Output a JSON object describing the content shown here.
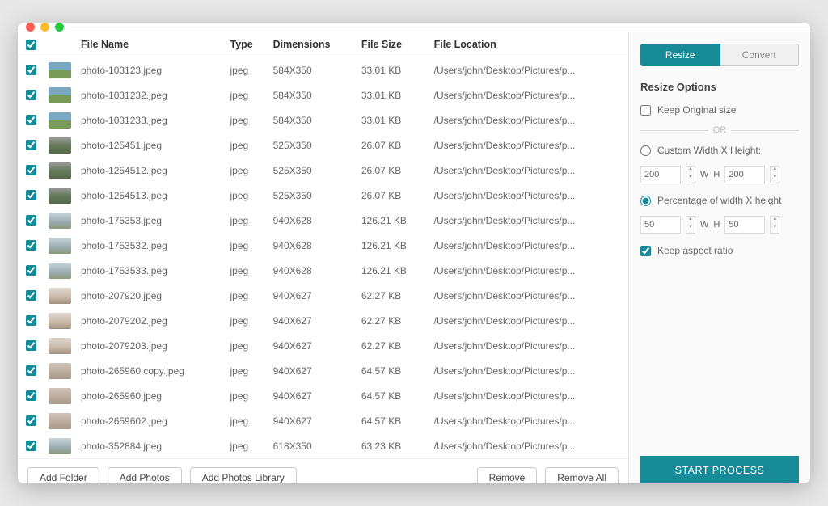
{
  "columns": {
    "fileName": "File Name",
    "type": "Type",
    "dimensions": "Dimensions",
    "fileSize": "File Size",
    "fileLocation": "File Location"
  },
  "rows": [
    {
      "thumb": "v1",
      "name": "photo-103123.jpeg",
      "type": "jpeg",
      "dim": "584X350",
      "size": "33.01 KB",
      "loc": "/Users/john/Desktop/Pictures/p..."
    },
    {
      "thumb": "v1",
      "name": "photo-1031232.jpeg",
      "type": "jpeg",
      "dim": "584X350",
      "size": "33.01 KB",
      "loc": "/Users/john/Desktop/Pictures/p..."
    },
    {
      "thumb": "v1",
      "name": "photo-1031233.jpeg",
      "type": "jpeg",
      "dim": "584X350",
      "size": "33.01 KB",
      "loc": "/Users/john/Desktop/Pictures/p..."
    },
    {
      "thumb": "v2",
      "name": "photo-125451.jpeg",
      "type": "jpeg",
      "dim": "525X350",
      "size": "26.07 KB",
      "loc": "/Users/john/Desktop/Pictures/p..."
    },
    {
      "thumb": "v2",
      "name": "photo-1254512.jpeg",
      "type": "jpeg",
      "dim": "525X350",
      "size": "26.07 KB",
      "loc": "/Users/john/Desktop/Pictures/p..."
    },
    {
      "thumb": "v2",
      "name": "photo-1254513.jpeg",
      "type": "jpeg",
      "dim": "525X350",
      "size": "26.07 KB",
      "loc": "/Users/john/Desktop/Pictures/p..."
    },
    {
      "thumb": "v3",
      "name": "photo-175353.jpeg",
      "type": "jpeg",
      "dim": "940X628",
      "size": "126.21 KB",
      "loc": "/Users/john/Desktop/Pictures/p..."
    },
    {
      "thumb": "v3",
      "name": "photo-1753532.jpeg",
      "type": "jpeg",
      "dim": "940X628",
      "size": "126.21 KB",
      "loc": "/Users/john/Desktop/Pictures/p..."
    },
    {
      "thumb": "v3",
      "name": "photo-1753533.jpeg",
      "type": "jpeg",
      "dim": "940X628",
      "size": "126.21 KB",
      "loc": "/Users/john/Desktop/Pictures/p..."
    },
    {
      "thumb": "v4",
      "name": "photo-207920.jpeg",
      "type": "jpeg",
      "dim": "940X627",
      "size": "62.27 KB",
      "loc": "/Users/john/Desktop/Pictures/p..."
    },
    {
      "thumb": "v4",
      "name": "photo-2079202.jpeg",
      "type": "jpeg",
      "dim": "940X627",
      "size": "62.27 KB",
      "loc": "/Users/john/Desktop/Pictures/p..."
    },
    {
      "thumb": "v4",
      "name": "photo-2079203.jpeg",
      "type": "jpeg",
      "dim": "940X627",
      "size": "62.27 KB",
      "loc": "/Users/john/Desktop/Pictures/p..."
    },
    {
      "thumb": "v5",
      "name": "photo-265960 copy.jpeg",
      "type": "jpeg",
      "dim": "940X627",
      "size": "64.57 KB",
      "loc": "/Users/john/Desktop/Pictures/p..."
    },
    {
      "thumb": "v5",
      "name": "photo-265960.jpeg",
      "type": "jpeg",
      "dim": "940X627",
      "size": "64.57 KB",
      "loc": "/Users/john/Desktop/Pictures/p..."
    },
    {
      "thumb": "v5",
      "name": "photo-2659602.jpeg",
      "type": "jpeg",
      "dim": "940X627",
      "size": "64.57 KB",
      "loc": "/Users/john/Desktop/Pictures/p..."
    },
    {
      "thumb": "v3",
      "name": "photo-352884.jpeg",
      "type": "jpeg",
      "dim": "618X350",
      "size": "63.23 KB",
      "loc": "/Users/john/Desktop/Pictures/p..."
    }
  ],
  "toolbar": {
    "addFolder": "Add Folder",
    "addPhotos": "Add Photos",
    "addPhotosLibrary": "Add Photos Library",
    "remove": "Remove",
    "removeAll": "Remove All"
  },
  "sidepanel": {
    "tabs": {
      "resize": "Resize",
      "convert": "Convert"
    },
    "title": "Resize Options",
    "keepOriginal": "Keep Original size",
    "or": "OR",
    "customWH": "Custom Width X Height:",
    "customW": "200",
    "customH": "200",
    "wLabel": "W",
    "hLabel": "H",
    "percentageWH": "Percentage of width X height",
    "percentW": "50",
    "percentH": "50",
    "keepAspect": "Keep aspect ratio",
    "start": "START PROCESS"
  }
}
